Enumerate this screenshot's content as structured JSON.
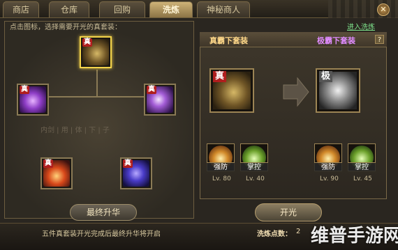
{
  "tabs": [
    {
      "label": "商店"
    },
    {
      "label": "仓库"
    },
    {
      "label": "回购"
    },
    {
      "label": "洗炼",
      "active": true
    },
    {
      "label": "神秘商人"
    }
  ],
  "close_icon": "close-icon",
  "left_panel": {
    "hint": "点击图标，选择需要开光的真套装：",
    "ghost_text": "内剑 | 用 | 体 | 下 | 子",
    "slots": [
      {
        "badge": "真",
        "icon": "gold-beast-armor-icon",
        "selected": true
      },
      {
        "badge": "真",
        "icon": "purple-beast-armor-icon"
      },
      {
        "badge": "真",
        "icon": "purple-tiger-armor-icon"
      },
      {
        "badge": "真",
        "icon": "phoenix-armor-icon"
      },
      {
        "badge": "真",
        "icon": "dragon-armor-icon"
      }
    ],
    "final_button": "最终升华"
  },
  "right_panel": {
    "link": "进入洗炼",
    "left_title": "真霸下套装",
    "right_title": "极霸下套装",
    "help": "?",
    "source_item": {
      "badge": "真",
      "icon": "gold-beast-armor-icon"
    },
    "target_item": {
      "badge": "极",
      "icon": "gray-beast-armor-icon"
    },
    "skills": [
      {
        "label": "强防",
        "level": "Lv. 80",
        "icon": "defense-icon"
      },
      {
        "label": "掌控",
        "level": "Lv. 40",
        "icon": "control-icon"
      },
      {
        "label": "强防",
        "level": "Lv. 90",
        "icon": "defense-icon"
      },
      {
        "label": "掌控",
        "level": "Lv. 45",
        "icon": "control-icon"
      }
    ],
    "open_button": "开光"
  },
  "footer": {
    "message": "五件真套装开光完成后最终升华将开启",
    "points_label": "洗炼点数：",
    "points_value": "2"
  },
  "watermark": "维普手游网",
  "colors": {
    "active_tab": "#cdb277",
    "selected_border": "#f3d34a",
    "badge_red": "#b01e1e"
  }
}
